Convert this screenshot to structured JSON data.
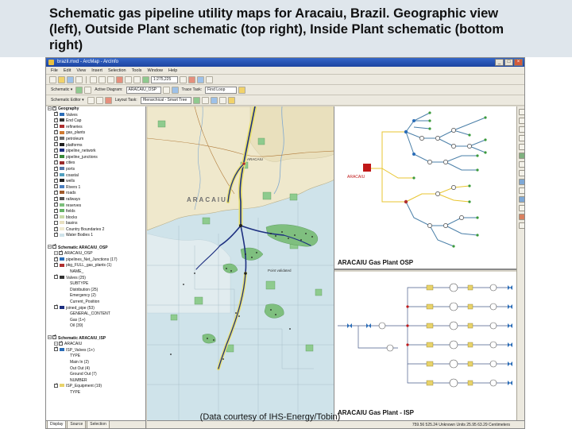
{
  "slide": {
    "title": "Schematic gas pipeline utility maps for Aracaiu, Brazil. Geographic view (left), Outside Plant schematic (top right), Inside Plant schematic (bottom right)",
    "credit": "(Data courtesy of IHS-Energy/Tobin)"
  },
  "window": {
    "title": "brazil.mxd - ArcMap - ArcInfo",
    "minimize": "_",
    "maximize": "□",
    "close": "×"
  },
  "menu": [
    "File",
    "Edit",
    "View",
    "Insert",
    "Selection",
    "Tools",
    "Window",
    "Help"
  ],
  "toolbars": {
    "scale_value": "1:275,225",
    "schematic_label": "Schematic ▾",
    "active_diagram_label": "Active Diagram:",
    "active_diagram_value": "ARACAIU_OSP",
    "trace_task_label": "Trace Task:",
    "trace_task_value": "Find Loop",
    "schematic_editor_label": "Schematic Editor ▾",
    "layout_task_label": "Layout Task:",
    "layout_task_value": "Hierarchical - Smart Tree"
  },
  "toc": {
    "layers": [
      {
        "label": "Geography",
        "kind": "group",
        "checked": true
      },
      {
        "label": "Valves",
        "kind": "layer",
        "checked": true,
        "sym": "#2a6db8"
      },
      {
        "label": "End Cap",
        "kind": "layer",
        "checked": true,
        "sym": "#333333"
      },
      {
        "label": "refineries",
        "kind": "layer",
        "checked": true,
        "sym": "#b03030"
      },
      {
        "label": "gas_plants",
        "kind": "layer",
        "checked": true,
        "sym": "#d07a30"
      },
      {
        "label": "petroleum",
        "kind": "layer",
        "checked": true,
        "sym": "#6b6b6b"
      },
      {
        "label": "platforms",
        "kind": "layer",
        "checked": true,
        "sym": "#1f1f1f"
      },
      {
        "label": "pipeline_network",
        "kind": "layer",
        "checked": true,
        "sym": "#1d2f80"
      },
      {
        "label": "pipeline_junctions",
        "kind": "layer",
        "checked": true,
        "sym": "#3a8a3a"
      },
      {
        "label": "cities",
        "kind": "layer",
        "checked": true,
        "sym": "#9a2a2a"
      },
      {
        "label": "ports",
        "kind": "layer",
        "checked": true,
        "sym": "#5577aa"
      },
      {
        "label": "coastal",
        "kind": "layer",
        "checked": true,
        "sym": "#4f9fbf"
      },
      {
        "label": "wells",
        "kind": "layer",
        "checked": true,
        "sym": "#222222"
      },
      {
        "label": "Rivers 1",
        "kind": "layer",
        "checked": true,
        "sym": "#4a7fc0"
      },
      {
        "label": "roads",
        "kind": "layer",
        "checked": true,
        "sym": "#a05a2a"
      },
      {
        "label": "railways",
        "kind": "layer",
        "checked": true,
        "sym": "#555555"
      },
      {
        "label": "reserves",
        "kind": "layer",
        "checked": true,
        "sym": "#7cbf7c"
      },
      {
        "label": "fields",
        "kind": "layer",
        "checked": true,
        "sym": "#66b366"
      },
      {
        "label": "blocks",
        "kind": "layer",
        "checked": true,
        "sym": "#c8d9a8"
      },
      {
        "label": "basins",
        "kind": "layer",
        "checked": false,
        "sym": "#e8e0c0"
      },
      {
        "label": "Country Boundaries 2",
        "kind": "layer",
        "checked": true,
        "sym": "#f0ead0"
      },
      {
        "label": "Water Bodies 1",
        "kind": "layer",
        "checked": true,
        "sym": "#cfe3ea"
      },
      {
        "label": "",
        "kind": "spacer"
      },
      {
        "label": "Schematic ARACAIU_OSP",
        "kind": "group",
        "checked": true
      },
      {
        "label": "ARACAIU_OSP",
        "kind": "subgroup",
        "checked": true
      },
      {
        "label": "pipelines_Net_Junctions (17)",
        "kind": "layer",
        "checked": true,
        "sym": "#2a6db8"
      },
      {
        "label": "pkg_FULL_gas_plants (1)",
        "kind": "layer",
        "checked": true,
        "sym": "#b03030"
      },
      {
        "label": "NAME_",
        "kind": "text"
      },
      {
        "label": "Valves (25)",
        "kind": "layer",
        "checked": true,
        "sym": "#333333"
      },
      {
        "label": "SUBTYPE",
        "kind": "text"
      },
      {
        "label": "Distribution (25)",
        "kind": "text"
      },
      {
        "label": "Emergency (2)",
        "kind": "text"
      },
      {
        "label": "Current_Position",
        "kind": "text"
      },
      {
        "label": "joined_pipe (53)",
        "kind": "layer",
        "checked": true,
        "sym": "#1d2f80"
      },
      {
        "label": "GENERAL_CONTENT",
        "kind": "text"
      },
      {
        "label": "Gas (1+)",
        "kind": "text"
      },
      {
        "label": "Oil (39)",
        "kind": "text"
      },
      {
        "label": "",
        "kind": "spacer"
      },
      {
        "label": "Schematic ARACAIU_ISP",
        "kind": "group",
        "checked": true
      },
      {
        "label": "ARACAIU",
        "kind": "subgroup",
        "checked": true
      },
      {
        "label": "ISP_Valves (1+)",
        "kind": "layer",
        "checked": true,
        "sym": "#2a6db8"
      },
      {
        "label": "TYPE",
        "kind": "text"
      },
      {
        "label": "Main In (2)",
        "kind": "text"
      },
      {
        "label": "Out Out (4)",
        "kind": "text"
      },
      {
        "label": "Ground Out (7)",
        "kind": "text"
      },
      {
        "label": "NUMBER",
        "kind": "text"
      },
      {
        "label": "ISP_Equipment (19)",
        "kind": "layer",
        "checked": true,
        "sym": "#e8d36a"
      },
      {
        "label": "TYPE",
        "kind": "text"
      }
    ],
    "tabs": [
      "Display",
      "Source",
      "Selection"
    ]
  },
  "map": {
    "city_label": "ARACAIU",
    "location_label": "Point validated",
    "city_small_label": "ARACAIU"
  },
  "osp": {
    "caption": "ARACAIU Gas Plant OSP",
    "plant_label": "ARACAIU"
  },
  "isp": {
    "caption": "ARACAIU Gas Plant - ISP"
  },
  "status": {
    "text": "759.56  525.24 Unknown Units    25.95  63.29 Centimeters"
  }
}
